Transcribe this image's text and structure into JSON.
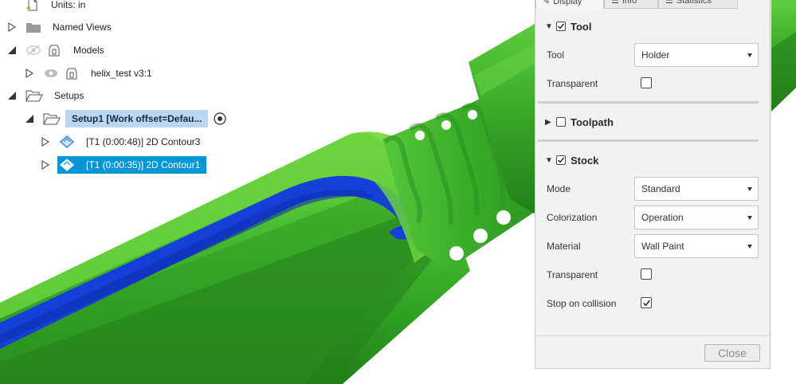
{
  "browser": {
    "items": [
      {
        "label": "Units: in"
      },
      {
        "label": "Named Views"
      },
      {
        "label": "Models"
      },
      {
        "label": "helix_test v3:1"
      },
      {
        "label": "Setups"
      },
      {
        "label": "Setup1 [Work offset=Defau..."
      },
      {
        "label": "[T1 (0:00:48)] 2D Contour3"
      },
      {
        "label": "[T1 (0:00:35)] 2D Contour1"
      }
    ]
  },
  "panel": {
    "tabs": [
      {
        "label": "Display"
      },
      {
        "label": "Info"
      },
      {
        "label": "Statistics"
      }
    ],
    "tool_section": {
      "title": "Tool",
      "checked": true,
      "tool_label": "Tool",
      "tool_value": "Holder",
      "transparent_label": "Transparent",
      "transparent_checked": false
    },
    "toolpath_section": {
      "title": "Toolpath",
      "checked": false
    },
    "stock_section": {
      "title": "Stock",
      "checked": true,
      "mode_label": "Mode",
      "mode_value": "Standard",
      "colorization_label": "Colorization",
      "colorization_value": "Operation",
      "material_label": "Material",
      "material_value": "Wall Paint",
      "transparent_label": "Transparent",
      "transparent_checked": false,
      "stop_label": "Stop on collision",
      "stop_checked": true
    },
    "close_label": "Close"
  },
  "colors": {
    "stock_green": "#3aa52a",
    "stock_blue": "#1540d8",
    "selection_blue": "#0696d7",
    "selection_light": "#b9d7f2"
  }
}
